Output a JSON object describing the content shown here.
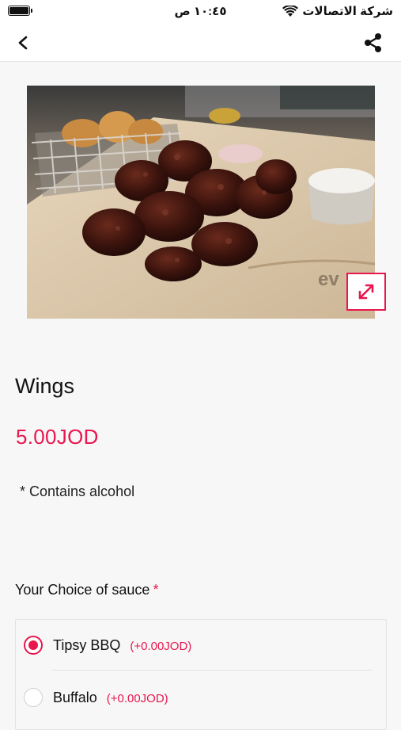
{
  "status_bar": {
    "time": "١٠:٤٥ ص",
    "carrier": "شركة الاتصالات",
    "icons": [
      "battery-icon",
      "wifi-icon"
    ]
  },
  "nav": {
    "back_icon": "chevron-left-icon",
    "share_icon": "share-icon"
  },
  "product": {
    "image_icon": "expand-icon",
    "name": "Wings",
    "price": "5.00JOD",
    "note": "* Contains alcohol"
  },
  "sauce_section": {
    "title": "Your Choice of sauce",
    "required_mark": "*",
    "options": [
      {
        "label": "Tipsy BBQ",
        "price": "(+0.00JOD)",
        "selected": true
      },
      {
        "label": "Buffalo",
        "price": "(+0.00JOD)",
        "selected": false
      }
    ]
  },
  "colors": {
    "accent": "#e8174e",
    "background": "#f7f7f7",
    "bar": "#ffffff"
  }
}
